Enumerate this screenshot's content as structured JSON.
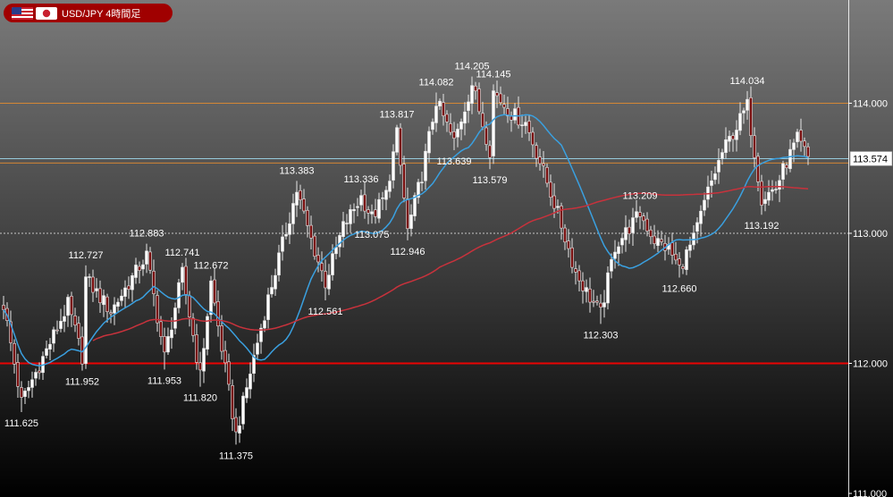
{
  "header": {
    "pair_label": "USD/JPY 4時間足",
    "flags": [
      "us-flag",
      "japan-flag"
    ]
  },
  "colors": {
    "background_top": "#7a7a7a",
    "background_bottom": "#000000",
    "candle_up": "#ffffff",
    "candle_down": "#7a1010",
    "ma_short": "#3aa0e0",
    "ma_long": "#c8323c",
    "horizontal_line_orange": "#e08a30",
    "horizontal_line_red": "#ff0000",
    "price_badge": "#ffffff",
    "badge_brand": "#a00000"
  },
  "chart_data": {
    "type": "candlestick",
    "symbol": "USD/JPY",
    "timeframe": "4時間足",
    "ylim": [
      111.0,
      114.45
    ],
    "y_ticks": [
      "114.000",
      "113.000",
      "112.000",
      "111.000"
    ],
    "current_price": "113.574",
    "grid": false,
    "horizontal_lines": [
      {
        "value": 114.0,
        "style": "orange"
      },
      {
        "value": 113.574,
        "style": "cyan"
      },
      {
        "value": 113.54,
        "style": "orange"
      },
      {
        "value": 113.0,
        "style": "dotted-white"
      },
      {
        "value": 112.0,
        "style": "red"
      }
    ],
    "swing_labels": [
      {
        "index": 5,
        "text": "111.625",
        "value": 111.625,
        "position": "below"
      },
      {
        "index": 22,
        "text": "111.952",
        "value": 111.952,
        "position": "below"
      },
      {
        "index": 23,
        "text": "112.727",
        "value": 112.727,
        "position": "above"
      },
      {
        "index": 40,
        "text": "112.883",
        "value": 112.883,
        "position": "above"
      },
      {
        "index": 45,
        "text": "111.953",
        "value": 111.953,
        "position": "below"
      },
      {
        "index": 50,
        "text": "112.741",
        "value": 112.741,
        "position": "above"
      },
      {
        "index": 55,
        "text": "111.820",
        "value": 111.82,
        "position": "below"
      },
      {
        "index": 58,
        "text": "112.672",
        "value": 112.672,
        "position": "above"
      },
      {
        "index": 65,
        "text": "111.375",
        "value": 111.375,
        "position": "below"
      },
      {
        "index": 82,
        "text": "113.383",
        "value": 113.383,
        "position": "above"
      },
      {
        "index": 90,
        "text": "112.561",
        "value": 112.561,
        "position": "below"
      },
      {
        "index": 100,
        "text": "113.336",
        "value": 113.336,
        "position": "above"
      },
      {
        "index": 103,
        "text": "113.075",
        "value": 113.075,
        "position": "below"
      },
      {
        "index": 113,
        "text": "112.946",
        "value": 112.946,
        "position": "below"
      },
      {
        "index": 110,
        "text": "113.817",
        "value": 113.817,
        "position": "above"
      },
      {
        "index": 121,
        "text": "114.082",
        "value": 114.082,
        "position": "above"
      },
      {
        "index": 126,
        "text": "113.639",
        "value": 113.639,
        "position": "below"
      },
      {
        "index": 131,
        "text": "114.205",
        "value": 114.205,
        "position": "above"
      },
      {
        "index": 137,
        "text": "114.145",
        "value": 114.145,
        "position": "above"
      },
      {
        "index": 136,
        "text": "113.579",
        "value": 113.579,
        "position": "below"
      },
      {
        "index": 167,
        "text": "112.303",
        "value": 112.303,
        "position": "below"
      },
      {
        "index": 178,
        "text": "113.209",
        "value": 113.209,
        "position": "above"
      },
      {
        "index": 189,
        "text": "112.660",
        "value": 112.66,
        "position": "below"
      },
      {
        "index": 208,
        "text": "114.034",
        "value": 114.034,
        "position": "above"
      },
      {
        "index": 212,
        "text": "113.192",
        "value": 113.192,
        "position": "below"
      }
    ],
    "path_points": [
      [
        0,
        112.45
      ],
      [
        5,
        111.7
      ],
      [
        12,
        112.1
      ],
      [
        18,
        112.45
      ],
      [
        22,
        112.05
      ],
      [
        23,
        112.65
      ],
      [
        30,
        112.4
      ],
      [
        40,
        112.83
      ],
      [
        45,
        112.05
      ],
      [
        50,
        112.69
      ],
      [
        55,
        111.9
      ],
      [
        58,
        112.62
      ],
      [
        65,
        111.45
      ],
      [
        70,
        112.05
      ],
      [
        74,
        112.5
      ],
      [
        82,
        113.33
      ],
      [
        86,
        112.95
      ],
      [
        90,
        112.62
      ],
      [
        95,
        113.05
      ],
      [
        100,
        113.28
      ],
      [
        103,
        113.12
      ],
      [
        107,
        113.3
      ],
      [
        110,
        113.76
      ],
      [
        113,
        113.02
      ],
      [
        117,
        113.45
      ],
      [
        121,
        114.02
      ],
      [
        126,
        113.7
      ],
      [
        131,
        114.15
      ],
      [
        136,
        113.64
      ],
      [
        137,
        114.09
      ],
      [
        142,
        113.92
      ],
      [
        146,
        113.85
      ],
      [
        150,
        113.55
      ],
      [
        155,
        113.15
      ],
      [
        160,
        112.7
      ],
      [
        163,
        112.55
      ],
      [
        167,
        112.38
      ],
      [
        171,
        112.9
      ],
      [
        178,
        113.15
      ],
      [
        182,
        112.95
      ],
      [
        186,
        112.88
      ],
      [
        189,
        112.73
      ],
      [
        193,
        112.95
      ],
      [
        197,
        113.32
      ],
      [
        201,
        113.62
      ],
      [
        205,
        113.82
      ],
      [
        208,
        113.98
      ],
      [
        212,
        113.27
      ],
      [
        216,
        113.35
      ],
      [
        219,
        113.55
      ],
      [
        222,
        113.72
      ],
      [
        225,
        113.58
      ]
    ],
    "candle_count": 226,
    "moving_averages": [
      {
        "style": "blue",
        "period": 20
      },
      {
        "style": "red",
        "period": 100
      }
    ]
  }
}
